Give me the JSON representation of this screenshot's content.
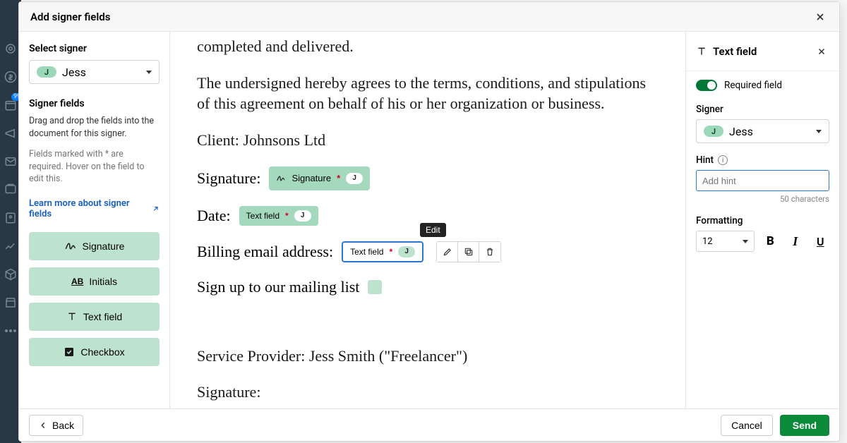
{
  "header": {
    "title": "Add signer fields"
  },
  "sidebar": {
    "select_label": "Select signer",
    "signer_initial": "J",
    "signer_name": "Jess",
    "fields_heading": "Signer fields",
    "fields_desc": "Drag and drop the fields into the document for this signer.",
    "required_note": "Fields marked with * are required. Hover on the field to edit this.",
    "learn_link": "Learn more about signer fields",
    "buttons": {
      "signature": "Signature",
      "initials": "Initials",
      "text": "Text field",
      "checkbox": "Checkbox"
    }
  },
  "document": {
    "p1": "completed and delivered.",
    "p2": "The undersigned hereby agrees to the terms, conditions, and stipulations of this agreement on behalf of his or her organization or business.",
    "client_line": "Client: Johnsons Ltd",
    "signature_label": "Signature:",
    "date_label": "Date:",
    "billing_label": "Billing email address:",
    "mailing_label": "Sign up to our mailing list",
    "provider_line": "Service Provider: Jess Smith (\"Freelancer\")",
    "signature2_label": "Signature:",
    "pill_signature": "Signature",
    "pill_text": "Text field",
    "pill_initial": "J",
    "edit_tooltip": "Edit"
  },
  "right": {
    "title": "Text field",
    "required_label": "Required field",
    "signer_label": "Signer",
    "signer_initial": "J",
    "signer_name": "Jess",
    "hint_label": "Hint",
    "hint_placeholder": "Add hint",
    "char_count": "50 characters",
    "formatting_label": "Formatting",
    "font_size": "12"
  },
  "footer": {
    "back": "Back",
    "cancel": "Cancel",
    "send": "Send"
  }
}
